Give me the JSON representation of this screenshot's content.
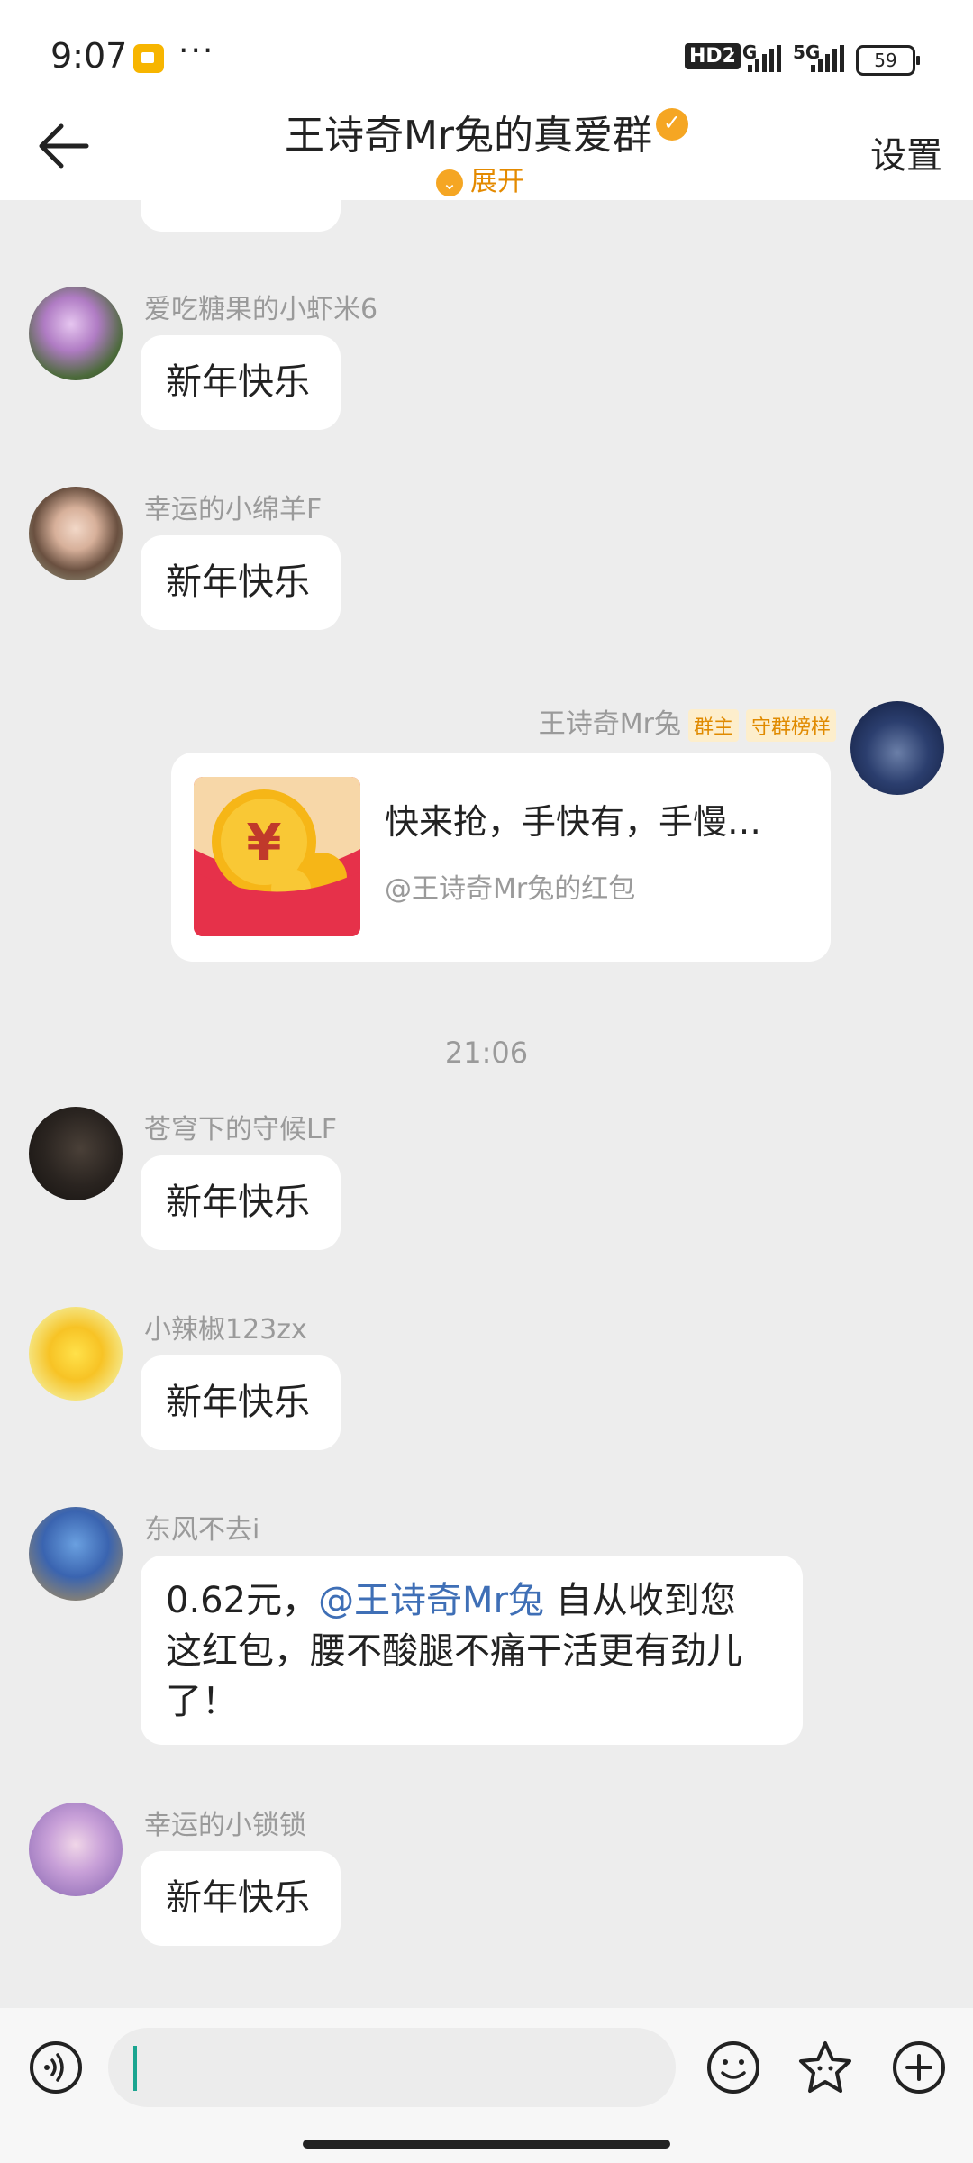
{
  "status_bar": {
    "time": "9:07",
    "dots": "···",
    "hd": "HD2",
    "net1": "5G",
    "net2": "5G",
    "battery": "59"
  },
  "header": {
    "title": "王诗奇Mr兔的真爱群",
    "expand_label": "展开",
    "settings_label": "设置"
  },
  "messages": [
    {
      "nick": "爱吃糖果的小虾米6",
      "text": "新年快乐"
    },
    {
      "nick": "幸运的小绵羊F",
      "text": "新年快乐"
    },
    {
      "nick": "王诗奇Mr兔",
      "tag_owner": "群主",
      "tag_guard": "守群榜样",
      "red_packet_title": "快来抢，手快有，手慢…",
      "red_packet_sub": "@王诗奇Mr兔的红包"
    },
    {
      "time_separator": "21:06"
    },
    {
      "nick": "苍穹下的守候LF",
      "text": "新年快乐"
    },
    {
      "nick": "小辣椒123zx",
      "text": "新年快乐"
    },
    {
      "nick": "东风不去i",
      "text_prefix": "0.62元，",
      "mention": "@王诗奇Mr兔",
      "text_line1_rest": " 自从收到您",
      "text_line2": "这红包，腰不酸腿不痛干活更有劲儿",
      "text_line3": "了！"
    },
    {
      "nick": "幸运的小锁锁",
      "text": "新年快乐"
    }
  ],
  "input": {
    "placeholder": ""
  },
  "colors": {
    "accent": "#f5a623",
    "mention": "#3f6fb6",
    "red_packet": "#e6314a"
  }
}
